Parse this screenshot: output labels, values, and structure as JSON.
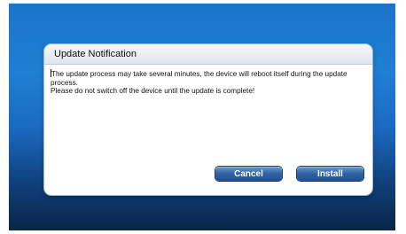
{
  "dialog": {
    "title": "Update Notification",
    "message_line1": "The update process may take several minutes, the device will reboot itself during the update process.",
    "message_line2": "Please do not switch off the device until the update is complete!",
    "cancel_label": "Cancel",
    "install_label": "Install"
  },
  "colors": {
    "background_top": "#1a74c9",
    "background_bottom": "#082646",
    "button_accent": "#2f63a6"
  }
}
